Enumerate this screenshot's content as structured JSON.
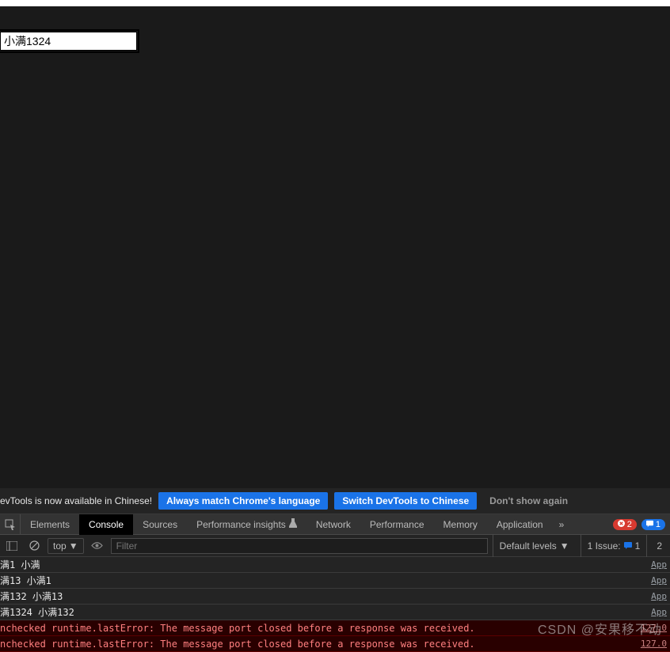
{
  "page": {
    "input_value": "小满1324"
  },
  "lang_bar": {
    "message": "evTools is now available in Chinese!",
    "btn_always": "Always match Chrome's language",
    "btn_switch": "Switch DevTools to Chinese",
    "btn_dont": "Don't show again"
  },
  "tabs": {
    "elements": "Elements",
    "console": "Console",
    "sources": "Sources",
    "perf_insights": "Performance insights",
    "network": "Network",
    "performance": "Performance",
    "memory": "Memory",
    "application": "Application",
    "more": "»"
  },
  "badges": {
    "error_count": "2",
    "info_count": "1"
  },
  "toolbar": {
    "top_label": "top",
    "filter_placeholder": "Filter",
    "levels_label": "Default levels",
    "issues_label": "1 Issue:",
    "issues_count": "1",
    "right_char": "2"
  },
  "logs": [
    {
      "msg": "满1 小满",
      "src": "App"
    },
    {
      "msg": "满13 小满1",
      "src": "App"
    },
    {
      "msg": "满132 小满13",
      "src": "App"
    },
    {
      "msg": "满1324 小满132",
      "src": "App"
    }
  ],
  "errors": [
    {
      "msg": "nchecked runtime.lastError: The message port closed before a response was received.",
      "src": "127.0"
    },
    {
      "msg": "nchecked runtime.lastError: The message port closed before a response was received.",
      "src": "127.0"
    }
  ],
  "watermark": "CSDN @安果移不动"
}
